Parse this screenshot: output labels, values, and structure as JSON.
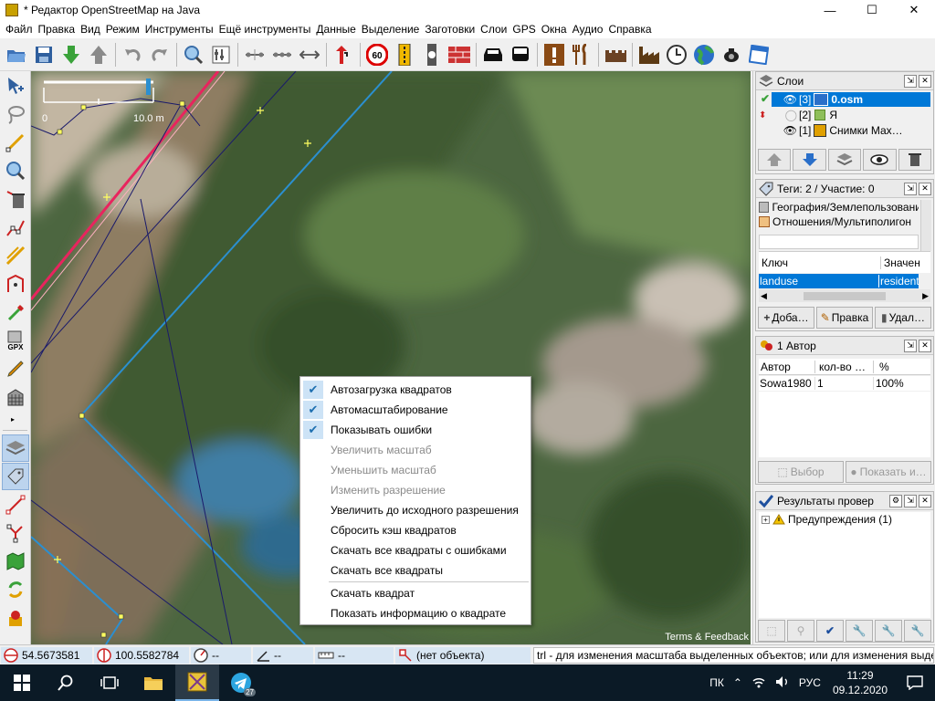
{
  "window": {
    "title": "* Редактор OpenStreetMap на Java",
    "minimize": "—",
    "maximize": "☐",
    "close": "✕"
  },
  "menu": [
    "Файл",
    "Правка",
    "Вид",
    "Режим",
    "Инструменты",
    "Ещё инструменты",
    "Данные",
    "Выделение",
    "Заготовки",
    "Слои",
    "GPS",
    "Окна",
    "Аудио",
    "Справка"
  ],
  "toolbar": {
    "icons": [
      "open-icon",
      "save-icon",
      "download-icon",
      "upload-icon",
      "undo-icon",
      "redo-icon",
      "zoom-icon",
      "preferences-icon",
      "align-icon",
      "distribute-icon",
      "split-icon",
      "reverse-way-icon",
      "speed-limit-icon",
      "traffic-signals-icon",
      "pedestrian-crossing-icon",
      "wall-icon",
      "car-icon",
      "bus-icon",
      "warning-icon",
      "restaurant-icon",
      "castle-icon",
      "factory-icon",
      "clock-icon",
      "globe-icon",
      "camera-icon",
      "calendar-icon"
    ],
    "speed_limit": "60"
  },
  "map": {
    "scale_label": "10.0 m",
    "scale_zero": "0",
    "attribution": "Terms & Feedback"
  },
  "context_menu": {
    "items": [
      {
        "label": "Автозагрузка квадратов",
        "checked": true,
        "enabled": true
      },
      {
        "label": "Автомасштабирование",
        "checked": true,
        "enabled": true
      },
      {
        "label": "Показывать ошибки",
        "checked": true,
        "enabled": true
      },
      {
        "label": "Увеличить масштаб",
        "checked": false,
        "enabled": false
      },
      {
        "label": "Уменьшить масштаб",
        "checked": false,
        "enabled": false
      },
      {
        "label": "Изменить разрешение",
        "checked": false,
        "enabled": false
      },
      {
        "label": "Увеличить до исходного разрешения",
        "checked": false,
        "enabled": true
      },
      {
        "label": "Сбросить кэш квадратов",
        "checked": false,
        "enabled": true
      },
      {
        "label": "Скачать все квадраты с ошибками",
        "checked": false,
        "enabled": true
      },
      {
        "label": "Скачать все квадраты",
        "checked": false,
        "enabled": true
      }
    ],
    "items_after_separator": [
      {
        "label": "Скачать квадрат"
      },
      {
        "label": "Показать информацию о квадрате"
      }
    ],
    "check_glyph": "✔"
  },
  "layers_panel": {
    "title": "Слои",
    "layers": [
      {
        "index": "[3]",
        "name": "0.osm",
        "selected": true
      },
      {
        "index": "[2]",
        "name": "Я",
        "selected": false
      },
      {
        "index": "[1]",
        "name": "Снимки Мах…",
        "selected": false
      }
    ]
  },
  "tags_panel": {
    "title": "Теги: 2 / Участие: 0",
    "presets": [
      "География/Землепользование",
      "Отношения/Мультиполигон"
    ],
    "col_key": "Ключ",
    "col_value": "Значен",
    "row_key": "landuse",
    "row_value": "resident",
    "btn_add": "Доба…",
    "btn_edit": "Правка",
    "btn_delete": "Удал…"
  },
  "authors_panel": {
    "title": "1 Автор",
    "col_author": "Автор",
    "col_count": "кол-во …",
    "col_pct": "%",
    "row_author": "Sowa1980",
    "row_count": "1",
    "row_pct": "100%",
    "btn_select": "Выбор",
    "btn_show": "Показать и…"
  },
  "validation_panel": {
    "title": "Результаты провер",
    "tree_item": "Предупреждения (1)",
    "expander": "+"
  },
  "statusbar": {
    "lat": "54.5673581",
    "lon": "100.5582784",
    "heading": "--",
    "angle": "--",
    "distance": "--",
    "object": "(нет объекта)",
    "help": "trl - для изменения масштаба выделенных объектов; или для изменения выделения"
  },
  "taskbar": {
    "telegram_badge": "27",
    "lang1": "ПК",
    "lang2": "РУС",
    "time": "11:29",
    "date": "09.12.2020"
  },
  "colors": {
    "selection": "#0078d7",
    "status_field": "#d8e6f3",
    "check_bg": "#cde3f6"
  }
}
